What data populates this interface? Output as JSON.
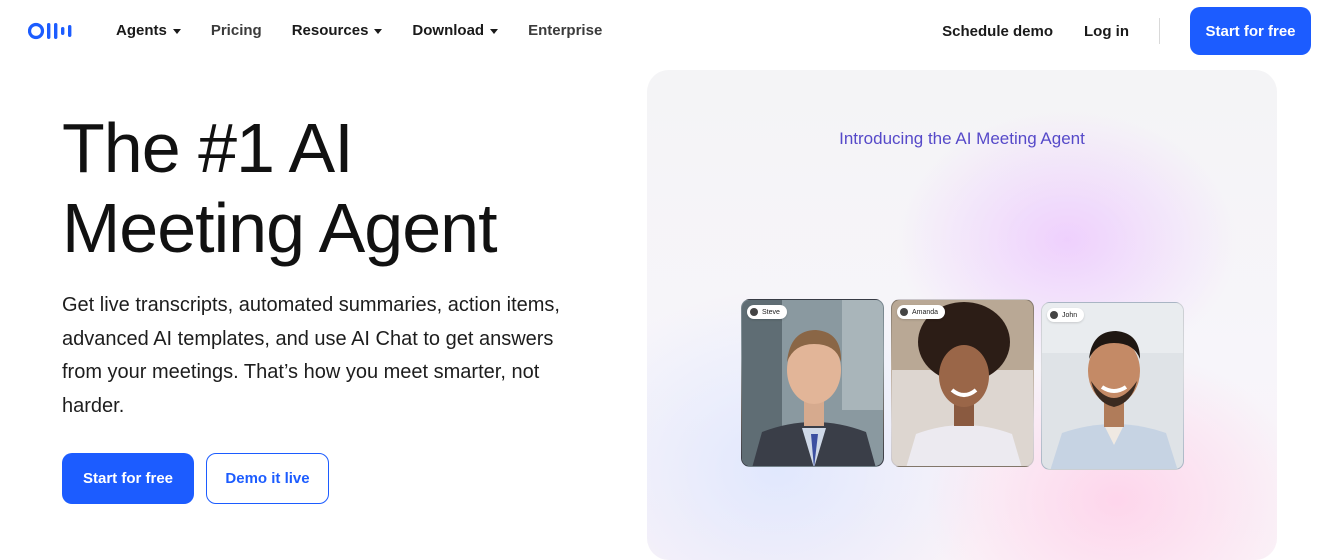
{
  "nav": {
    "logo_label": "Otter",
    "items": [
      {
        "label": "Agents",
        "dropdown": true
      },
      {
        "label": "Pricing",
        "dropdown": false
      },
      {
        "label": "Resources",
        "dropdown": true
      },
      {
        "label": "Download",
        "dropdown": true
      },
      {
        "label": "Enterprise",
        "dropdown": false
      }
    ],
    "schedule_demo": "Schedule demo",
    "log_in": "Log in",
    "cta": "Start for free"
  },
  "hero": {
    "title_line1": "The #1 AI",
    "title_line2": "Meeting Agent",
    "description": "Get live transcripts, automated summaries, action items, advanced AI templates, and use AI Chat to get answers from your meetings. That’s how you meet smarter, not harder.",
    "primary_cta": "Start for free",
    "secondary_cta": "Demo it live"
  },
  "media": {
    "heading": "Introducing the AI Meeting Agent",
    "participants": [
      {
        "name": "Steve"
      },
      {
        "name": "Amanda"
      },
      {
        "name": "John"
      }
    ]
  },
  "colors": {
    "brand_blue": "#1c5cff",
    "heading_purple": "#5649c9"
  }
}
